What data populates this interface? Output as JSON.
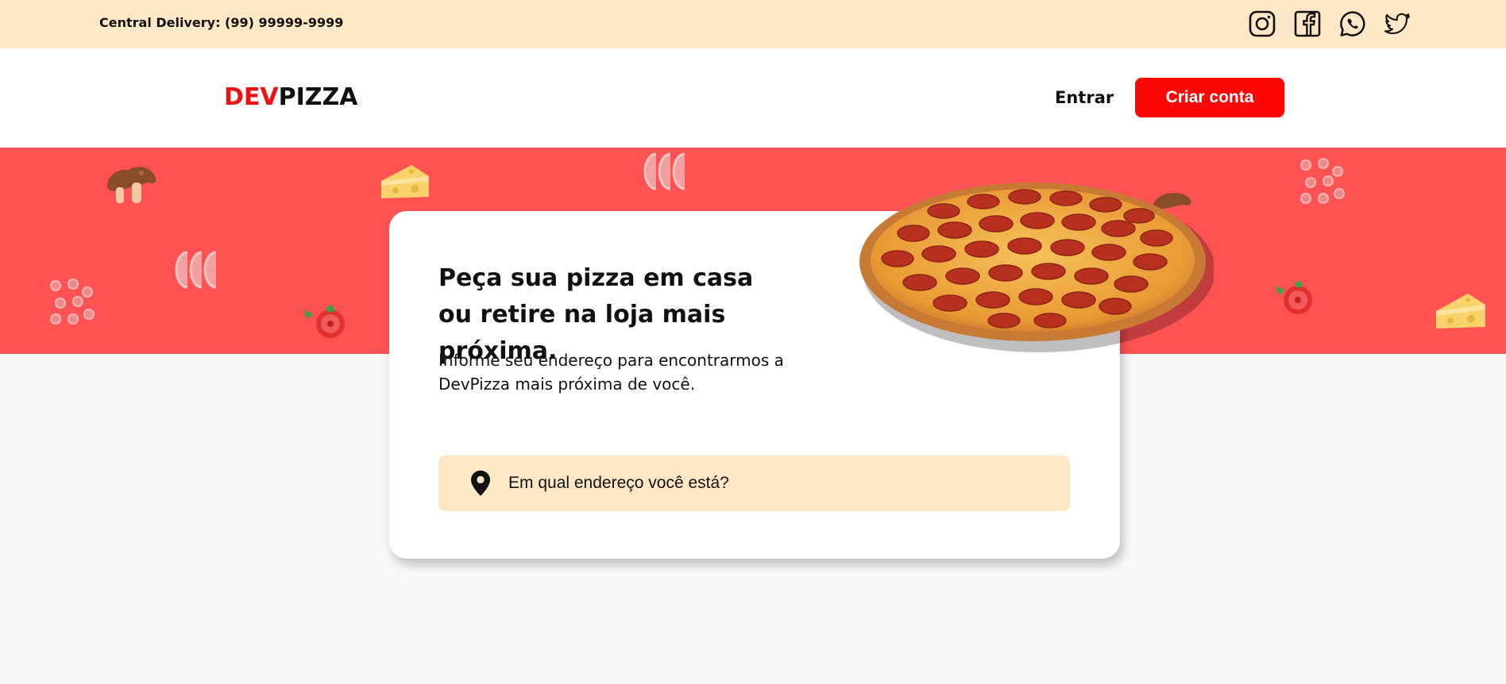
{
  "topbar": {
    "delivery_text": "Central Delivery: (99) 99999-9999",
    "social": [
      "instagram-icon",
      "facebook-icon",
      "whatsapp-icon",
      "twitter-icon"
    ]
  },
  "header": {
    "logo_part1": "DEV",
    "logo_part2": "PIZZA",
    "login_label": "Entrar",
    "signup_label": "Criar conta"
  },
  "hero": {
    "title": "Peça sua pizza em casa ou retire na loja mais próxima.",
    "subtitle": "Informe seu endereço para encontrarmos a DevPizza mais próxima de você.",
    "address_placeholder": "Em qual endereço você está?",
    "address_value": ""
  },
  "colors": {
    "topbar_bg": "#ffe8c6",
    "hero_bg": "#ff5252",
    "brand_red": "#ff0606",
    "page_bg": "#f8f8f8"
  }
}
